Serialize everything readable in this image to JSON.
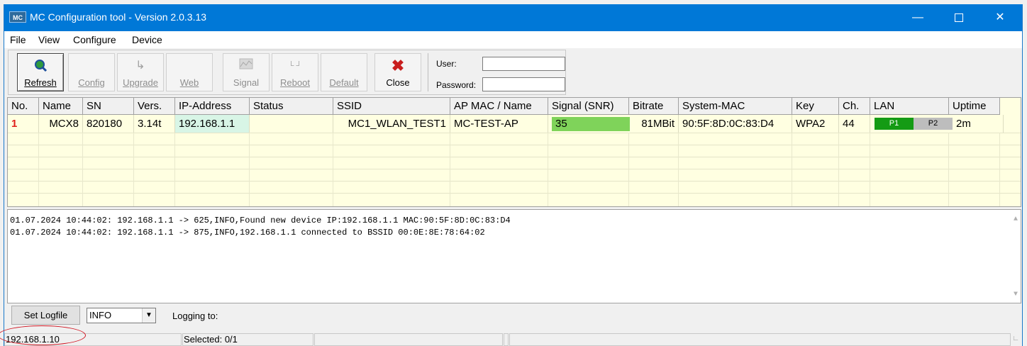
{
  "window": {
    "title": "MC Configuration tool - Version 2.0.3.13",
    "icon_text": "MC"
  },
  "menu": [
    "File",
    "View",
    "Configure",
    "Device"
  ],
  "toolbar": {
    "buttons": [
      {
        "label": "Refresh",
        "icon": "refresh-search-icon"
      },
      {
        "label": "Config",
        "icon": "config-icon"
      },
      {
        "label": "Upgrade",
        "icon": "upgrade-icon"
      },
      {
        "label": "Web",
        "icon": "web-icon"
      },
      {
        "label": "Signal",
        "icon": "signal-icon"
      },
      {
        "label": "Reboot",
        "icon": "reboot-icon"
      },
      {
        "label": "Default",
        "icon": "default-icon"
      },
      {
        "label": "Close",
        "icon": "close-x-icon"
      }
    ],
    "user_label": "User:",
    "password_label": "Password:",
    "user_value": "",
    "password_value": ""
  },
  "table": {
    "headers": [
      "No.",
      "Name",
      "SN",
      "Vers.",
      "IP-Address",
      "Status",
      "SSID",
      "AP MAC / Name",
      "Signal (SNR)",
      "Bitrate",
      "System-MAC",
      "Key",
      "Ch.",
      "LAN",
      "Uptime"
    ],
    "rows": [
      {
        "no": "1",
        "name": "MCX8",
        "sn": "820180",
        "vers": "3.14t",
        "ip": "192.168.1.1",
        "status": "",
        "ssid": "MC1_WLAN_TEST1",
        "ap": "MC-TEST-AP",
        "signal": "35",
        "bitrate": "81MBit",
        "sysmac": "90:5F:8D:0C:83:D4",
        "key": "WPA2",
        "ch": "44",
        "lan_p1": "P1",
        "lan_p2": "P2",
        "uptime": "2m"
      }
    ]
  },
  "log": {
    "lines": [
      "01.07.2024 10:44:02: 192.168.1.1 -> 625,INFO,Found new device IP:192.168.1.1 MAC:90:5F:8D:0C:83:D4",
      "01.07.2024 10:44:02: 192.168.1.1 -> 875,INFO,192.168.1.1 connected to BSSID 00:0E:8E:78:64:02"
    ]
  },
  "logging": {
    "set_logfile_label": "Set Logfile",
    "level": "INFO",
    "logging_to_label": "Logging to:"
  },
  "status": {
    "ip": "192.168.1.10",
    "selected": "Selected: 0/1"
  },
  "colors": {
    "titlebar": "#0078d7",
    "grid_bg": "#ffffe1",
    "signal_good": "#7fd35a",
    "lan_active": "#149b14",
    "lan_inactive": "#bdbdbd",
    "annotation": "#d0121e"
  }
}
